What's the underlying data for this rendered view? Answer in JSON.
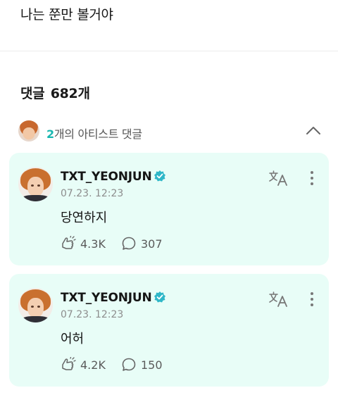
{
  "post": {
    "text": "나는 쭌만 볼거야"
  },
  "comments": {
    "label": "댓글",
    "count": "682개"
  },
  "artist_comments": {
    "count": "2",
    "label": "개의 아티스트 댓글"
  },
  "cards": [
    {
      "username": "TXT_YEONJUN",
      "timestamp": "07.23. 12:23",
      "text": "당연하지",
      "reactions": "4.3K",
      "replies": "307"
    },
    {
      "username": "TXT_YEONJUN",
      "timestamp": "07.23. 12:23",
      "text": "어허",
      "reactions": "4.2K",
      "replies": "150"
    }
  ],
  "icons": {
    "verified": "verified-badge-icon",
    "translate": "translate-icon",
    "more": "more-vertical-icon",
    "reactions": "reaction-cheer-icon",
    "replies": "speech-bubble-icon",
    "collapse": "chevron-up-icon"
  },
  "colors": {
    "accent": "#19b7b0",
    "card_bg": "#e8fdf7",
    "verified": "#2fb7c8"
  }
}
